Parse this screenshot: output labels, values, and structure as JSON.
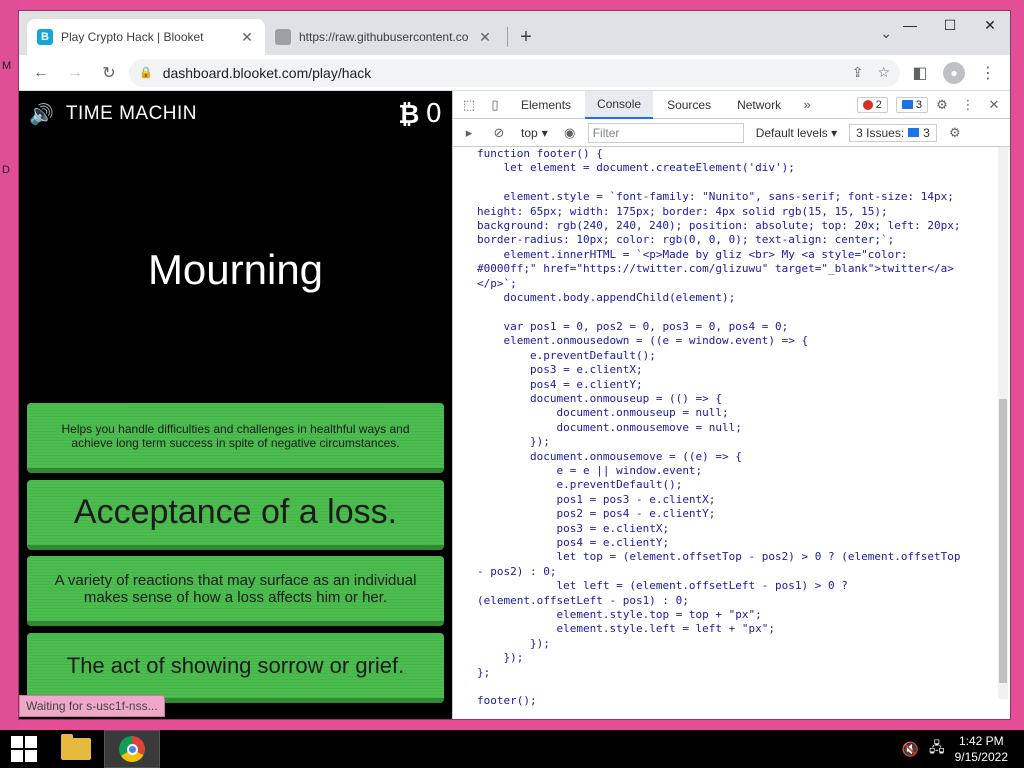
{
  "desktop": {
    "edge_glyphs": [
      "M",
      "D"
    ]
  },
  "browser": {
    "tabs": [
      {
        "title": "Play Crypto Hack | Blooket",
        "favicon": "B",
        "close": "✕",
        "active": true
      },
      {
        "title": "https://raw.githubusercontent.com",
        "favicon": "",
        "close": "✕",
        "active": false
      }
    ],
    "new_tab": "+",
    "tab_search": "⌄",
    "window_controls": {
      "minimize": "—",
      "maximize": "☐",
      "close": "✕"
    },
    "address": "dashboard.blooket.com/play/hack",
    "nav": {
      "back": "←",
      "forward": "→",
      "reload": "↻",
      "lock": "🔒"
    },
    "toolbar_icons": {
      "share": "⇪",
      "star": "☆",
      "sidepanel": "◧",
      "menu": "⋮"
    }
  },
  "game": {
    "speaker": "🔊",
    "mode_title": "TIME MACHIN",
    "crypto_symbol": "₿",
    "crypto_value": "0",
    "question": "Mourning",
    "answers": [
      "Helps you handle difficulties and challenges in healthful ways and achieve long term success in spite of negative circumstances.",
      "Acceptance of a loss.",
      "A variety of reactions that may surface as an individual makes sense of how a loss affects him or her.",
      "The act of showing sorrow or grief."
    ],
    "status": "Waiting for s-usc1f-nss..."
  },
  "devtools": {
    "tabs": [
      "Elements",
      "Console",
      "Sources",
      "Network"
    ],
    "active_tab": "Console",
    "more_tabs": "»",
    "error_count": "2",
    "message_count": "3",
    "context": "top",
    "filter_placeholder": "Filter",
    "levels": "Default levels",
    "issues_label": "3 Issues:",
    "issues_count": "3",
    "code_lines": [
      "function footer() {",
      "    let element = document.createElement('div');",
      "",
      "    element.style = `font-family: \"Nunito\", sans-serif; font-size: 14px;",
      "height: 65px; width: 175px; border: 4px solid rgb(15, 15, 15);",
      "background: rgb(240, 240, 240); position: absolute; top: 20x; left: 20px;",
      "border-radius: 10px; color: rgb(0, 0, 0); text-align: center;`;",
      "    element.innerHTML = `<p>Made by gliz <br> My <a style=\"color:",
      "#0000ff;\" href=\"https://twitter.com/glizuwu\" target=\"_blank\">twitter</a>",
      "</p>`;",
      "    document.body.appendChild(element);",
      "",
      "    var pos1 = 0, pos2 = 0, pos3 = 0, pos4 = 0;",
      "    element.onmousedown = ((e = window.event) => {",
      "        e.preventDefault();",
      "        pos3 = e.clientX;",
      "        pos4 = e.clientY;",
      "        document.onmouseup = (() => {",
      "            document.onmouseup = null;",
      "            document.onmousemove = null;",
      "        });",
      "        document.onmousemove = ((e) => {",
      "            e = e || window.event;",
      "            e.preventDefault();",
      "            pos1 = pos3 - e.clientX;",
      "            pos2 = pos4 - e.clientY;",
      "            pos3 = e.clientX;",
      "            pos4 = e.clientY;",
      "            let top = (element.offsetTop - pos2) > 0 ? (element.offsetTop",
      "- pos2) : 0;",
      "            let left = (element.offsetLeft - pos1) > 0 ?",
      "(element.offsetLeft - pos1) : 0;",
      "            element.style.top = top + \"px\";",
      "            element.style.left = left + \"px\";",
      "        });",
      "    });",
      "};",
      "",
      "footer();"
    ]
  },
  "taskbar": {
    "time": "1:42 PM",
    "date": "9/15/2022",
    "tray_volume": "🔇",
    "tray_network": "🖧"
  }
}
